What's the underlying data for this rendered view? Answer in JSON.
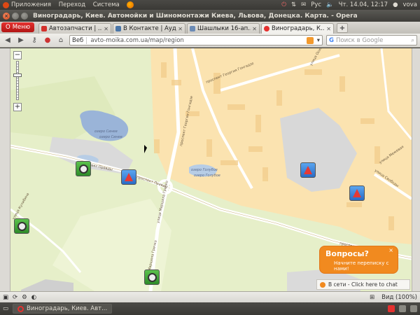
{
  "system": {
    "menus": [
      "Приложения",
      "Переход",
      "Система"
    ],
    "lang": "Рус",
    "datetime": "Чт. 14.04, 12:17",
    "user": "vova"
  },
  "window": {
    "title": "Виноградарь, Киев. Автомойки и Шиномонтажи Киева, Львова, Донецка. Карта. - Opera"
  },
  "browser": {
    "menu_label": "Меню",
    "tabs": [
      {
        "label": "Автозапчасти | ...",
        "color": "#d3302b"
      },
      {
        "label": "В Контакте | Ауд...",
        "color": "#4a76a8"
      },
      {
        "label": "Шашлыки 16-ап...",
        "color": "#6b8bb5"
      },
      {
        "label": "Виноградарь, К...",
        "color": "#e5312f"
      }
    ],
    "new_tab": "+",
    "address_prefix": "Веб",
    "url": "avto-moika.com.ua/map/region",
    "search_placeholder": "Поиск в Google",
    "status_zoom": "Вид (100%)"
  },
  "map": {
    "labels": {
      "lake1_a": "озеро Синее",
      "lake1_b": "озеро Синее",
      "lake2_a": "озеро Голубое",
      "lake2_b": "озеро Голубое",
      "street1": "проспект Георгия Гонгадзе",
      "street2": "проспект Георгия Гонгадзе",
      "street3": "проспект Правды",
      "street4": "проспект Правды",
      "street5": "улица Межевая",
      "street6": "проспект Правды",
      "street7": "улица Свободы",
      "street8": "улица Маршала Гречко",
      "street9": "улица Маршала Гречко",
      "street10": "улица Осиповского",
      "street11": "улица Кулибина"
    }
  },
  "chat": {
    "title": "Вопросы?",
    "subtitle": "Начните переписку с нами!",
    "close": "×",
    "status": "В сети - Click here to chat"
  },
  "taskbar": {
    "task_label": "Виноградарь, Киев. Авт..."
  }
}
